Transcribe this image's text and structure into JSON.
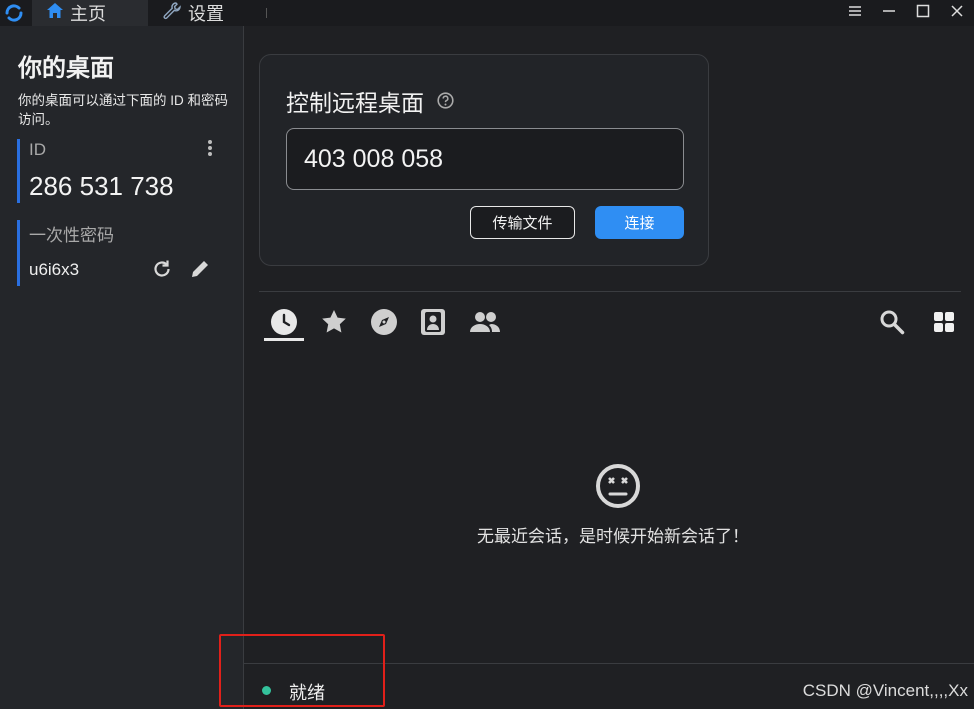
{
  "titlebar": {
    "tabs": [
      {
        "label": "主页",
        "icon": "home-icon",
        "active": true
      },
      {
        "label": "设置",
        "icon": "wrench-icon",
        "active": false
      }
    ]
  },
  "left": {
    "title": "你的桌面",
    "description": "你的桌面可以通过下面的 ID 和密码访问。",
    "id_label": "ID",
    "id_value": "286 531 738",
    "password_label": "一次性密码",
    "password_value": "u6i6x3"
  },
  "connect": {
    "title": "控制远程桌面",
    "id_input_value": "403 008 058",
    "transfer_label": "传输文件",
    "connect_label": "连接"
  },
  "peers": {
    "tabs": [
      "recent-clock-icon",
      "favorite-star-icon",
      "discover-compass-icon",
      "address-book-icon",
      "group-people-icon"
    ],
    "empty_message": "无最近会话，是时候开始新会话了！"
  },
  "status": {
    "text": "就绪",
    "color": "#34c29c"
  },
  "watermark": "CSDN @Vincent,,,,Xx",
  "colors": {
    "accent": "#2f8ef3",
    "highlight_box": "#e0201a"
  }
}
